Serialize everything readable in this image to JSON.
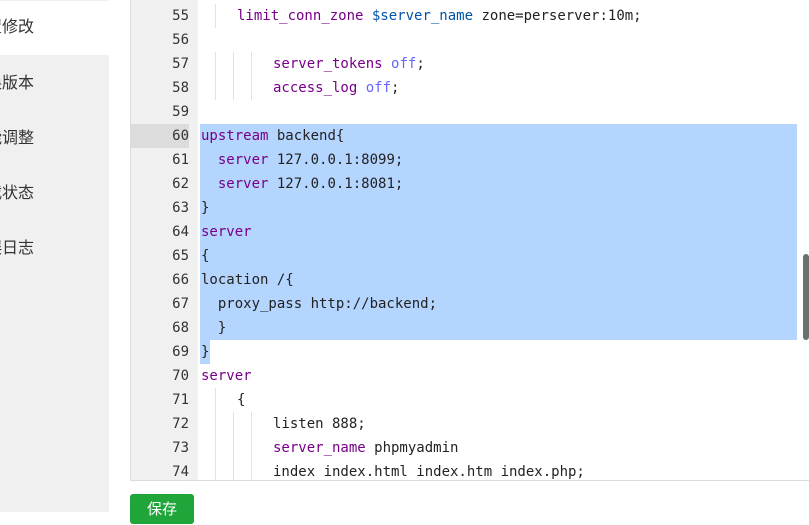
{
  "sidebar": {
    "items": [
      {
        "label": "配置修改",
        "display": "置修改",
        "active": true
      },
      {
        "label": "切换版本",
        "display": "换版本",
        "active": false
      },
      {
        "label": "性能调整",
        "display": "能调整",
        "active": false
      },
      {
        "label": "负载状态",
        "display": "载状态",
        "active": false
      },
      {
        "label": "错误日志",
        "display": "误日志",
        "active": false
      }
    ]
  },
  "editor": {
    "active_line": "60",
    "lines": [
      {
        "n": "55",
        "tokens": [
          [
            "kw",
            "limit_conn_zone"
          ],
          [
            "plain",
            " "
          ],
          [
            "var",
            "$server_name"
          ],
          [
            "plain",
            " zone=perserver:10m;"
          ]
        ],
        "indent": 1
      },
      {
        "n": "56",
        "tokens": [],
        "indent": 0
      },
      {
        "n": "57",
        "tokens": [
          [
            "kw",
            "server_tokens"
          ],
          [
            "plain",
            " "
          ],
          [
            "atom",
            "off"
          ],
          [
            "plain",
            ";"
          ]
        ],
        "indent": 2
      },
      {
        "n": "58",
        "tokens": [
          [
            "kw",
            "access_log"
          ],
          [
            "plain",
            " "
          ],
          [
            "atom",
            "off"
          ],
          [
            "plain",
            ";"
          ]
        ],
        "indent": 2
      },
      {
        "n": "59",
        "tokens": [],
        "indent": 0
      },
      {
        "n": "60",
        "tokens": [
          [
            "kw",
            "upstream"
          ],
          [
            "plain",
            " backend{"
          ]
        ],
        "indent": 0,
        "selected": true
      },
      {
        "n": "61",
        "tokens": [
          [
            "plain",
            "  "
          ],
          [
            "kw",
            "server"
          ],
          [
            "plain",
            " 127.0.0.1:8099;"
          ]
        ],
        "indent": 0,
        "selected": true
      },
      {
        "n": "62",
        "tokens": [
          [
            "plain",
            "  "
          ],
          [
            "kw",
            "server"
          ],
          [
            "plain",
            " 127.0.0.1:8081;"
          ]
        ],
        "indent": 0,
        "selected": true
      },
      {
        "n": "63",
        "tokens": [
          [
            "plain",
            "}"
          ]
        ],
        "indent": 0,
        "selected": true
      },
      {
        "n": "64",
        "tokens": [
          [
            "kw",
            "server"
          ]
        ],
        "indent": 0,
        "selected": true
      },
      {
        "n": "65",
        "tokens": [
          [
            "plain",
            "{"
          ]
        ],
        "indent": 0,
        "selected": true
      },
      {
        "n": "66",
        "tokens": [
          [
            "plain",
            "location /{"
          ]
        ],
        "indent": 0,
        "selected": true
      },
      {
        "n": "67",
        "tokens": [
          [
            "plain",
            "  proxy_pass http://backend;"
          ]
        ],
        "indent": 0,
        "selected": true
      },
      {
        "n": "68",
        "tokens": [
          [
            "plain",
            "  }"
          ]
        ],
        "indent": 0,
        "selected": true
      },
      {
        "n": "69",
        "tokens": [
          [
            "plain",
            "}"
          ]
        ],
        "indent": 0,
        "selected": "partial"
      },
      {
        "n": "70",
        "tokens": [
          [
            "kw",
            "server"
          ]
        ],
        "indent": 0
      },
      {
        "n": "71",
        "tokens": [
          [
            "plain",
            "{"
          ]
        ],
        "indent": 1
      },
      {
        "n": "72",
        "tokens": [
          [
            "plain",
            "listen 888;"
          ]
        ],
        "indent": 2
      },
      {
        "n": "73",
        "tokens": [
          [
            "kw",
            "server_name"
          ],
          [
            "plain",
            " phpmyadmin"
          ]
        ],
        "indent": 2
      },
      {
        "n": "74",
        "tokens": [
          [
            "plain",
            "index index.html index.htm index.php;"
          ]
        ],
        "indent": 2
      }
    ]
  },
  "actions": {
    "save_label": "保存"
  },
  "colors": {
    "keyword": "#770088",
    "variable": "#0055aa",
    "atom": "#6666ff",
    "selection": "#b4d5fe",
    "save_button": "#20a53a"
  }
}
